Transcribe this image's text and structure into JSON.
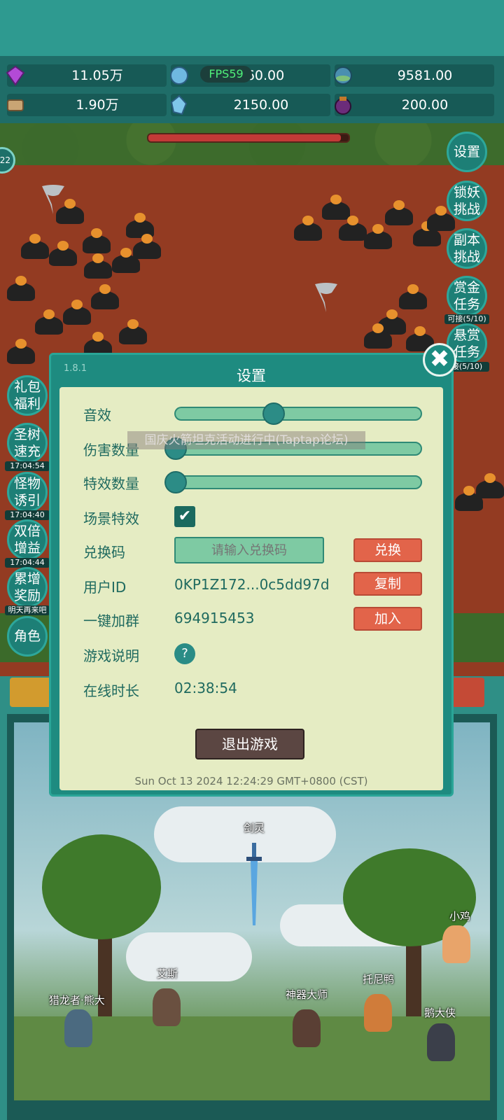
{
  "resources": [
    {
      "icon": "purple-gem-icon",
      "value": "11.05万"
    },
    {
      "icon": "blue-crystal-icon",
      "value": "360.00"
    },
    {
      "icon": "sphere-icon",
      "value": "9581.00"
    },
    {
      "icon": "scroll-icon",
      "value": "1.90万"
    },
    {
      "icon": "ice-shard-icon",
      "value": "2150.00"
    },
    {
      "icon": "purple-pouch-icon",
      "value": "200.00"
    }
  ],
  "fps": "FPS59",
  "level_badge": "22",
  "right_buttons": [
    {
      "label": "设置",
      "sub": ""
    },
    {
      "label": "锁妖挑战",
      "sub": ""
    },
    {
      "label": "副本挑战",
      "sub": ""
    },
    {
      "label": "赏金任务",
      "sub": "可接(5/10)"
    },
    {
      "label": "悬赏任务",
      "sub": "接(5/10)"
    }
  ],
  "left_buttons": [
    {
      "label": "礼包福利",
      "sub": ""
    },
    {
      "label": "圣树速充",
      "sub": "17:04:54"
    },
    {
      "label": "怪物诱引",
      "sub": "17:04:40"
    },
    {
      "label": "双倍增益",
      "sub": "17:04:44"
    },
    {
      "label": "累增奖励",
      "sub": "明天再来吧"
    },
    {
      "label": "角色",
      "sub": ""
    }
  ],
  "settings": {
    "version": "1.8.1",
    "title": "设置",
    "sound_label": "音效",
    "sound_level": 0.4,
    "damage_label": "伤害数量",
    "damage_level": 0.0,
    "effects_label": "特效数量",
    "effects_level": 0.0,
    "scene_label": "场景特效",
    "scene_checked": "✔",
    "code_label": "兑换码",
    "code_placeholder": "请输入兑换码",
    "code_button": "兑换",
    "user_label": "用户ID",
    "user_id": "0KP1Z172...0c5dd97d",
    "copy_button": "复制",
    "group_label": "一键加群",
    "group_id": "694915453",
    "join_button": "加入",
    "help_label": "游戏说明",
    "help_icon": "?",
    "online_label": "在线时长",
    "online_time": "02:38:54",
    "exit_button": "退出游戏",
    "datetime": "Sun Oct 13 2024 12:24:29 GMT+0800 (CST)",
    "close_icon": "✖"
  },
  "banner": "国庆火箭坦克活动进行中(Taptap论坛)",
  "characters": [
    {
      "name": "剑灵"
    },
    {
      "name": "小鸡"
    },
    {
      "name": "艾斯"
    },
    {
      "name": "托尼鸭"
    },
    {
      "name": "猎龙者·熊大"
    },
    {
      "name": "神器大师"
    },
    {
      "name": "鹅大侠"
    }
  ]
}
